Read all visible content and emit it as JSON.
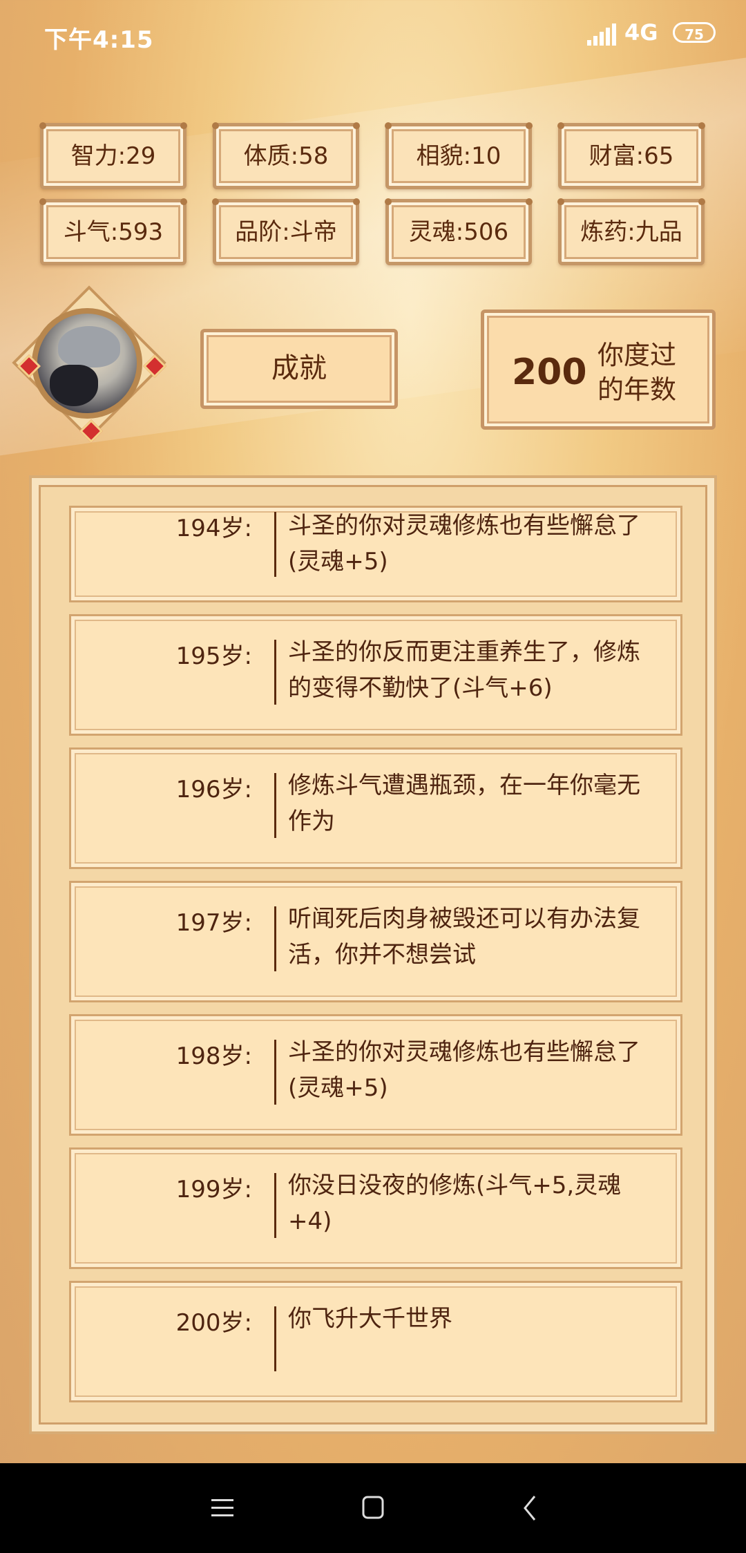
{
  "status_bar": {
    "time": "下午4:15",
    "network": "4G",
    "battery": "75"
  },
  "stats": [
    {
      "label": "智力:29"
    },
    {
      "label": "体质:58"
    },
    {
      "label": "相貌:10"
    },
    {
      "label": "财富:65"
    },
    {
      "label": "斗气:593"
    },
    {
      "label": "品阶:斗帝"
    },
    {
      "label": "灵魂:506"
    },
    {
      "label": "炼药:九品"
    }
  ],
  "achievement_button": "成就",
  "years": {
    "value": "200",
    "label": "你度过的年数"
  },
  "log": [
    {
      "age": "194岁:",
      "text": "斗圣的你对灵魂修炼也有些懈怠了(灵魂+5)"
    },
    {
      "age": "195岁:",
      "text": "斗圣的你反而更注重养生了，修炼的变得不勤快了(斗气+6)"
    },
    {
      "age": "196岁:",
      "text": "修炼斗气遭遇瓶颈，在一年你毫无作为"
    },
    {
      "age": "197岁:",
      "text": "听闻死后肉身被毁还可以有办法复活，你并不想尝试"
    },
    {
      "age": "198岁:",
      "text": "斗圣的你对灵魂修炼也有些懈怠了(灵魂+5)"
    },
    {
      "age": "199岁:",
      "text": "你没日没夜的修炼(斗气+5,灵魂+4)"
    },
    {
      "age": "200岁:",
      "text": "你飞升大千世界"
    }
  ],
  "nav": {
    "menu_icon": "menu-icon",
    "home_icon": "home-icon",
    "back_icon": "back-icon"
  }
}
